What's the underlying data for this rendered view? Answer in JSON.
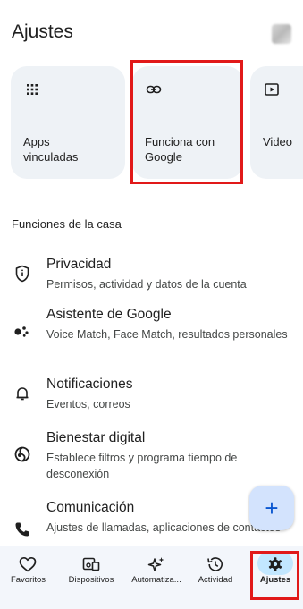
{
  "header": {
    "title": "Ajustes"
  },
  "cards": [
    {
      "label": "Apps\nvinculadas",
      "icon": "apps-grid-icon"
    },
    {
      "label": "Funciona con\nGoogle",
      "icon": "link-icon"
    },
    {
      "label": "Video",
      "icon": "video-icon"
    }
  ],
  "section": {
    "title": "Funciones de la casa"
  },
  "settings": [
    {
      "title": "Privacidad",
      "subtitle": "Permisos, actividad y datos de la cuenta",
      "icon": "privacy-shield-icon"
    },
    {
      "title": "Asistente de Google",
      "subtitle": "Voice Match, Face Match, resultados personales",
      "icon": "google-assistant-icon"
    },
    {
      "title": "Notificaciones",
      "subtitle": "Eventos, correos",
      "icon": "bell-icon"
    },
    {
      "title": "Bienestar digital",
      "subtitle": "Establece filtros y programa tiempo de desconexión",
      "icon": "digital-wellbeing-icon"
    },
    {
      "title": "Comunicación",
      "subtitle": "Ajustes de llamadas, aplicaciones de contactos",
      "icon": "phone-icon"
    }
  ],
  "fab": {
    "label": "+"
  },
  "nav": [
    {
      "label": "Favoritos",
      "icon": "heart-icon"
    },
    {
      "label": "Dispositivos",
      "icon": "devices-icon"
    },
    {
      "label": "Automatiza...",
      "icon": "sparkle-icon"
    },
    {
      "label": "Actividad",
      "icon": "history-icon"
    },
    {
      "label": "Ajustes",
      "icon": "gear-icon",
      "active": true
    }
  ],
  "colors": {
    "highlight": "#e11919",
    "accent": "#0b57d0",
    "active_pill": "#c2e7ff",
    "card_bg": "#eef2f6"
  }
}
